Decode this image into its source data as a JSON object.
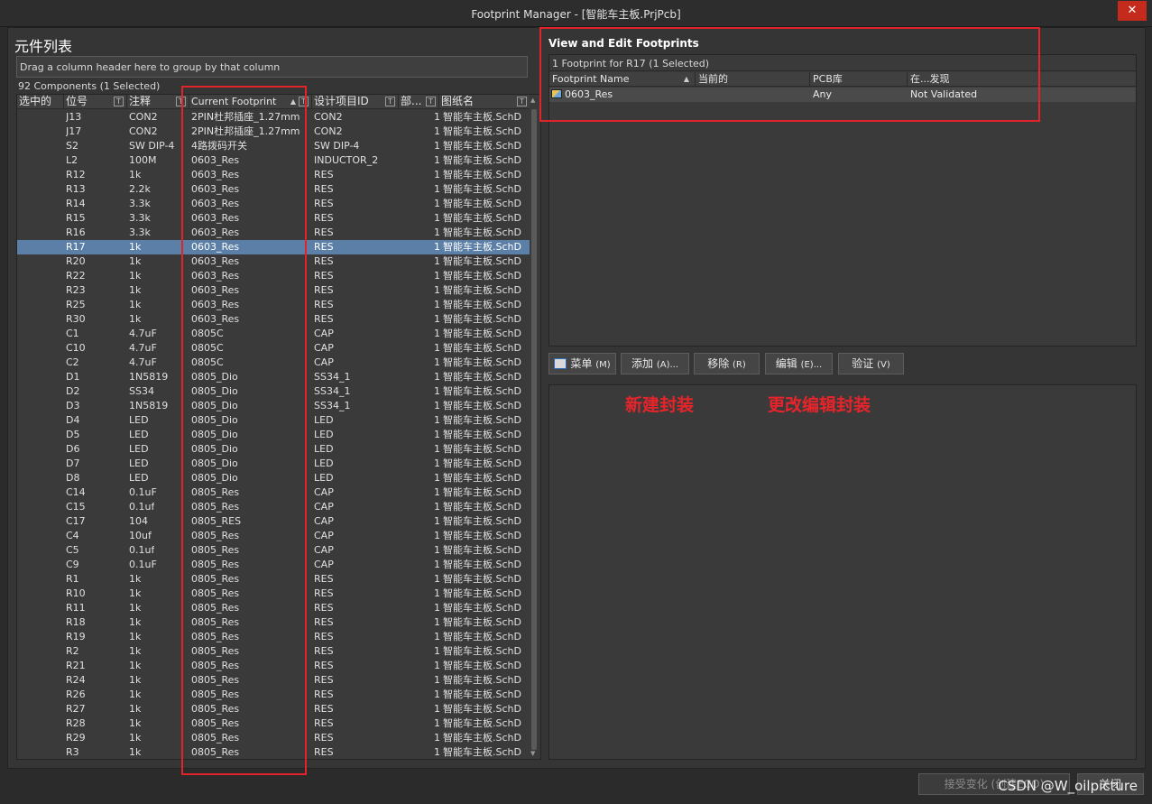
{
  "window": {
    "title": "Footprint Manager - [智能车主板.PrjPcb]",
    "close_glyph": "✕"
  },
  "left": {
    "title": "元件列表",
    "group_hint": "Drag a column header here to group by that column",
    "count": "92 Components (1 Selected)",
    "columns": [
      "选中的",
      "位号",
      "注释",
      "Current Footprint",
      "设计项目ID",
      "部...",
      "图纸名"
    ],
    "filter_glyph": "T",
    "rows": [
      [
        "J13",
        "CON2",
        "2PIN杜邦插座_1.27mm",
        "CON2",
        "1",
        "智能车主板.SchD"
      ],
      [
        "J17",
        "CON2",
        "2PIN杜邦插座_1.27mm",
        "CON2",
        "1",
        "智能车主板.SchD"
      ],
      [
        "S2",
        "SW DIP-4",
        "4路拨码开关",
        "SW DIP-4",
        "1",
        "智能车主板.SchD"
      ],
      [
        "L2",
        "100M",
        "0603_Res",
        "INDUCTOR_2",
        "1",
        "智能车主板.SchD"
      ],
      [
        "R12",
        "1k",
        "0603_Res",
        "RES",
        "1",
        "智能车主板.SchD"
      ],
      [
        "R13",
        "2.2k",
        "0603_Res",
        "RES",
        "1",
        "智能车主板.SchD"
      ],
      [
        "R14",
        "3.3k",
        "0603_Res",
        "RES",
        "1",
        "智能车主板.SchD"
      ],
      [
        "R15",
        "3.3k",
        "0603_Res",
        "RES",
        "1",
        "智能车主板.SchD"
      ],
      [
        "R16",
        "3.3k",
        "0603_Res",
        "RES",
        "1",
        "智能车主板.SchD"
      ],
      [
        "R17",
        "1k",
        "0603_Res",
        "RES",
        "1",
        "智能车主板.SchD"
      ],
      [
        "R20",
        "1k",
        "0603_Res",
        "RES",
        "1",
        "智能车主板.SchD"
      ],
      [
        "R22",
        "1k",
        "0603_Res",
        "RES",
        "1",
        "智能车主板.SchD"
      ],
      [
        "R23",
        "1k",
        "0603_Res",
        "RES",
        "1",
        "智能车主板.SchD"
      ],
      [
        "R25",
        "1k",
        "0603_Res",
        "RES",
        "1",
        "智能车主板.SchD"
      ],
      [
        "R30",
        "1k",
        "0603_Res",
        "RES",
        "1",
        "智能车主板.SchD"
      ],
      [
        "C1",
        "4.7uF",
        "0805C",
        "CAP",
        "1",
        "智能车主板.SchD"
      ],
      [
        "C10",
        "4.7uF",
        "0805C",
        "CAP",
        "1",
        "智能车主板.SchD"
      ],
      [
        "C2",
        "4.7uF",
        "0805C",
        "CAP",
        "1",
        "智能车主板.SchD"
      ],
      [
        "D1",
        "1N5819",
        "0805_Dio",
        "SS34_1",
        "1",
        "智能车主板.SchD"
      ],
      [
        "D2",
        "SS34",
        "0805_Dio",
        "SS34_1",
        "1",
        "智能车主板.SchD"
      ],
      [
        "D3",
        "1N5819",
        "0805_Dio",
        "SS34_1",
        "1",
        "智能车主板.SchD"
      ],
      [
        "D4",
        "LED",
        "0805_Dio",
        "LED",
        "1",
        "智能车主板.SchD"
      ],
      [
        "D5",
        "LED",
        "0805_Dio",
        "LED",
        "1",
        "智能车主板.SchD"
      ],
      [
        "D6",
        "LED",
        "0805_Dio",
        "LED",
        "1",
        "智能车主板.SchD"
      ],
      [
        "D7",
        "LED",
        "0805_Dio",
        "LED",
        "1",
        "智能车主板.SchD"
      ],
      [
        "D8",
        "LED",
        "0805_Dio",
        "LED",
        "1",
        "智能车主板.SchD"
      ],
      [
        "C14",
        "0.1uF",
        "0805_Res",
        "CAP",
        "1",
        "智能车主板.SchD"
      ],
      [
        "C15",
        "0.1uf",
        "0805_Res",
        "CAP",
        "1",
        "智能车主板.SchD"
      ],
      [
        "C17",
        "104",
        "0805_RES",
        "CAP",
        "1",
        "智能车主板.SchD"
      ],
      [
        "C4",
        "10uf",
        "0805_Res",
        "CAP",
        "1",
        "智能车主板.SchD"
      ],
      [
        "C5",
        "0.1uf",
        "0805_Res",
        "CAP",
        "1",
        "智能车主板.SchD"
      ],
      [
        "C9",
        "0.1uF",
        "0805_Res",
        "CAP",
        "1",
        "智能车主板.SchD"
      ],
      [
        "R1",
        "1k",
        "0805_Res",
        "RES",
        "1",
        "智能车主板.SchD"
      ],
      [
        "R10",
        "1k",
        "0805_Res",
        "RES",
        "1",
        "智能车主板.SchD"
      ],
      [
        "R11",
        "1k",
        "0805_Res",
        "RES",
        "1",
        "智能车主板.SchD"
      ],
      [
        "R18",
        "1k",
        "0805_Res",
        "RES",
        "1",
        "智能车主板.SchD"
      ],
      [
        "R19",
        "1k",
        "0805_Res",
        "RES",
        "1",
        "智能车主板.SchD"
      ],
      [
        "R2",
        "1k",
        "0805_Res",
        "RES",
        "1",
        "智能车主板.SchD"
      ],
      [
        "R21",
        "1k",
        "0805_Res",
        "RES",
        "1",
        "智能车主板.SchD"
      ],
      [
        "R24",
        "1k",
        "0805_Res",
        "RES",
        "1",
        "智能车主板.SchD"
      ],
      [
        "R26",
        "1k",
        "0805_Res",
        "RES",
        "1",
        "智能车主板.SchD"
      ],
      [
        "R27",
        "1k",
        "0805_Res",
        "RES",
        "1",
        "智能车主板.SchD"
      ],
      [
        "R28",
        "1k",
        "0805_Res",
        "RES",
        "1",
        "智能车主板.SchD"
      ],
      [
        "R29",
        "1k",
        "0805_Res",
        "RES",
        "1",
        "智能车主板.SchD"
      ],
      [
        "R3",
        "1k",
        "0805_Res",
        "RES",
        "1",
        "智能车主板.SchD"
      ]
    ],
    "selected_row": 9
  },
  "right": {
    "title": "View and Edit Footprints",
    "caption": "1 Footprint for R17 (1 Selected)",
    "columns": [
      "Footprint Name",
      "当前的",
      "PCB库",
      "在...发现"
    ],
    "row": [
      "0603_Res",
      "",
      "Any",
      "Not Validated"
    ],
    "buttons": [
      {
        "label": "菜单",
        "accel": "(M)"
      },
      {
        "label": "添加",
        "accel": "(A)..."
      },
      {
        "label": "移除",
        "accel": "(R)"
      },
      {
        "label": "编辑",
        "accel": "(E)..."
      },
      {
        "label": "验证",
        "accel": "(V)"
      }
    ],
    "annotations": [
      "新建封装",
      "更改编辑封装"
    ]
  },
  "footer": {
    "accept_label": "接受变化 (创建ECO)",
    "close_label": "关闭"
  },
  "watermark": "CSDN @W_oilpicture",
  "colors": {
    "selection": "#5b7fa6",
    "annotation": "#e0242a",
    "close": "#c42b1c"
  }
}
